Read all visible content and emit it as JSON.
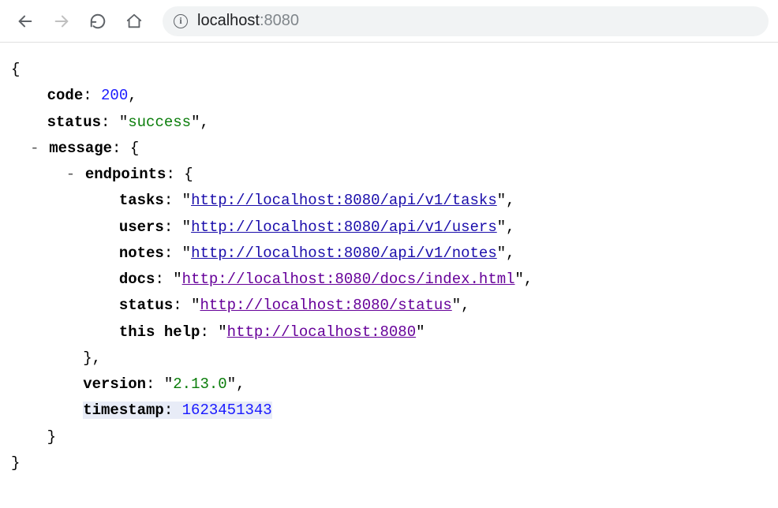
{
  "toolbar": {
    "url_host": "localhost",
    "url_port": ":8080"
  },
  "json": {
    "code_key": "code",
    "code_val": "200",
    "status_key": "status",
    "status_val": "success",
    "message_key": "message",
    "endpoints_key": "endpoints",
    "tasks_key": "tasks",
    "tasks_val": "http://localhost:8080/api/v1/tasks",
    "users_key": "users",
    "users_val": "http://localhost:8080/api/v1/users",
    "notes_key": "notes",
    "notes_val": "http://localhost:8080/api/v1/notes",
    "docs_key": "docs",
    "docs_val": "http://localhost:8080/docs/index.html",
    "statep_key": "status",
    "statep_val": "http://localhost:8080/status",
    "thishelp_key": "this help",
    "thishelp_val": "http://localhost:8080",
    "version_key": "version",
    "version_val": "2.13.0",
    "timestamp_key": "timestamp",
    "timestamp_val": "1623451343"
  }
}
